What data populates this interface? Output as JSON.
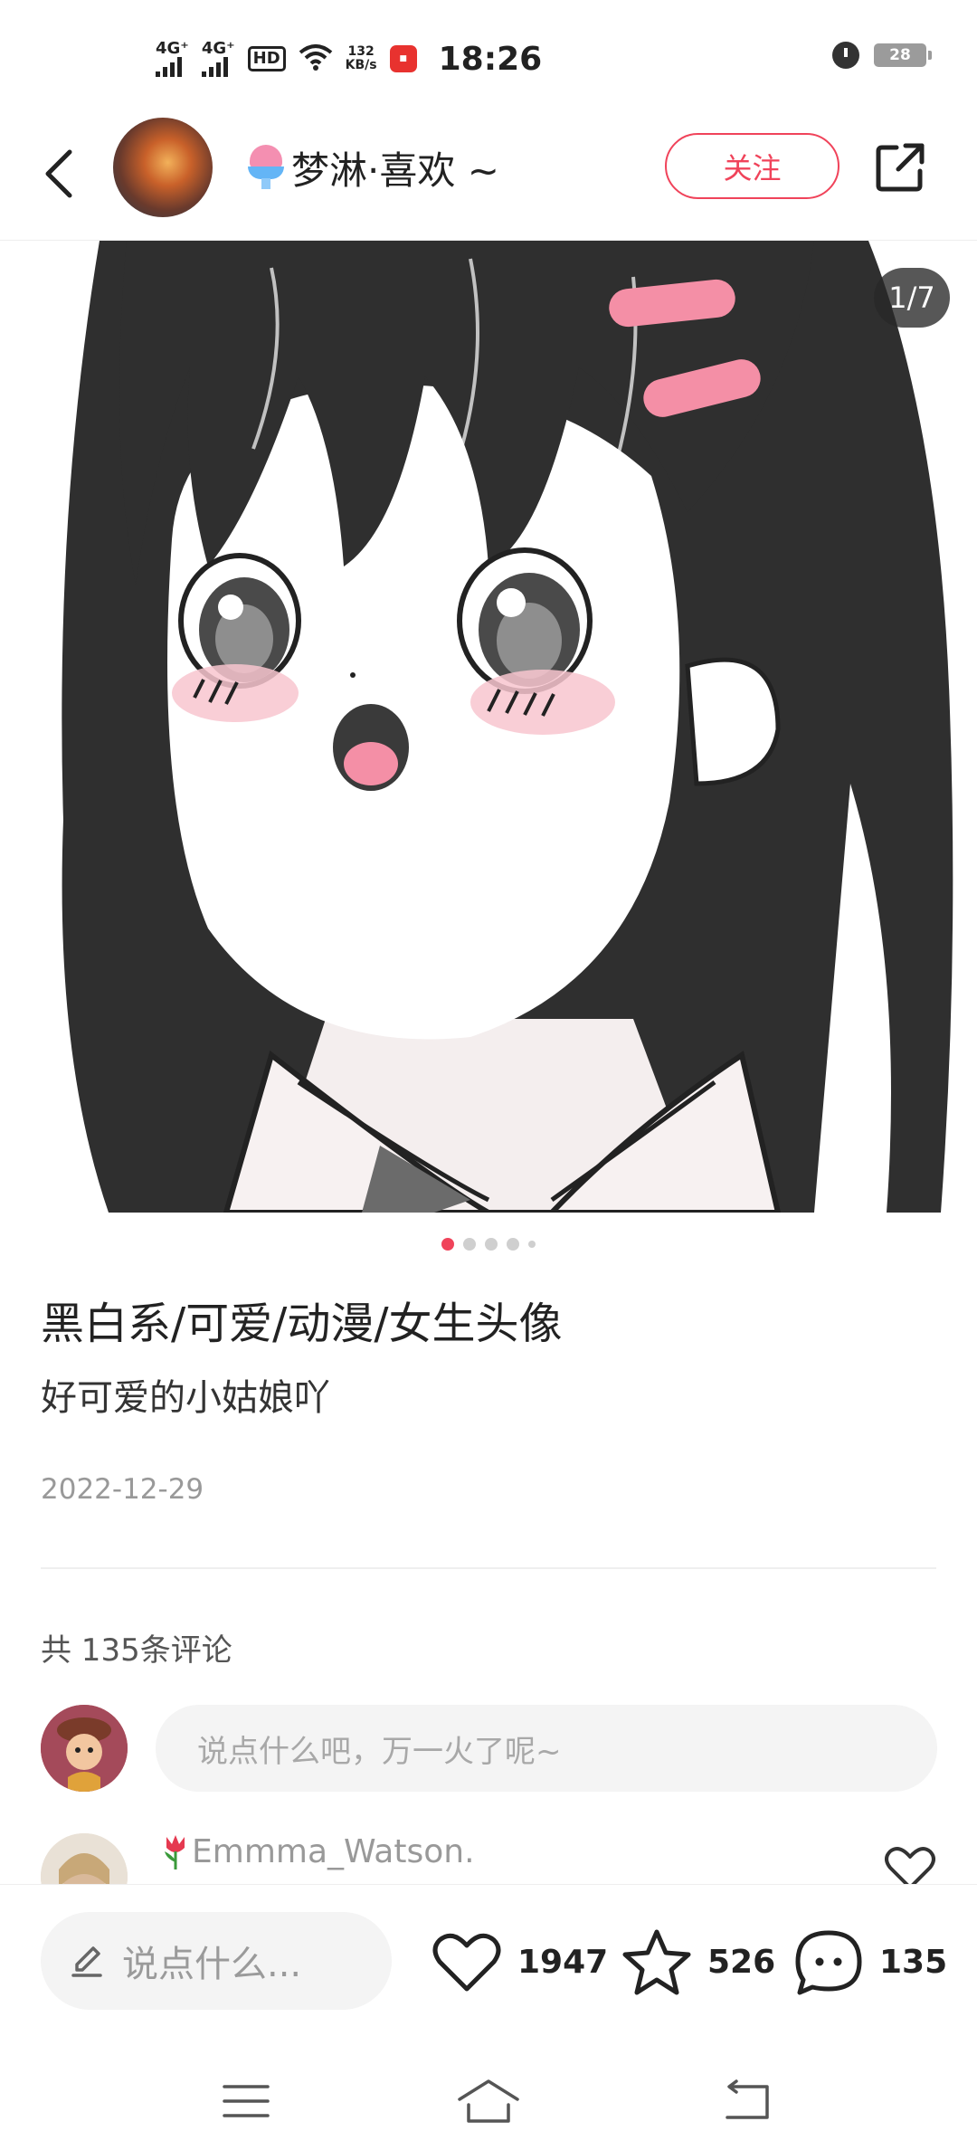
{
  "status_bar": {
    "signal1": "4G⁺",
    "signal2": "4G⁺",
    "hd": "HD",
    "speed_value": "132",
    "speed_unit": "KB/s",
    "time": "18:26",
    "battery": "28",
    "icons": [
      "signal-icon",
      "signal-icon",
      "hd-icon",
      "wifi-icon",
      "app-notification-icon",
      "alarm-icon",
      "battery-icon"
    ]
  },
  "header": {
    "username": "梦淋·喜欢 ~",
    "follow_label": "关注",
    "icons": [
      "back-arrow-icon",
      "share-icon"
    ]
  },
  "gallery": {
    "page_counter": "1/7",
    "dot_count": 5,
    "active_dot": 0
  },
  "post": {
    "title": "黑白系/可爱/动漫/女生头像",
    "description": "好可爱的小姑娘吖",
    "date": "2022-12-29"
  },
  "comments": {
    "count_label": "共 135条评论",
    "input_placeholder": "说点什么吧，万一火了呢~",
    "first_comment": {
      "username": "Emmma_Watson."
    }
  },
  "bottom_bar": {
    "say_placeholder": "说点什么...",
    "likes": "1947",
    "favorites": "526",
    "comments": "135"
  },
  "colors": {
    "accent": "#f0435a",
    "text": "#222222",
    "muted": "#999999",
    "input_bg": "#f4f4f4"
  }
}
